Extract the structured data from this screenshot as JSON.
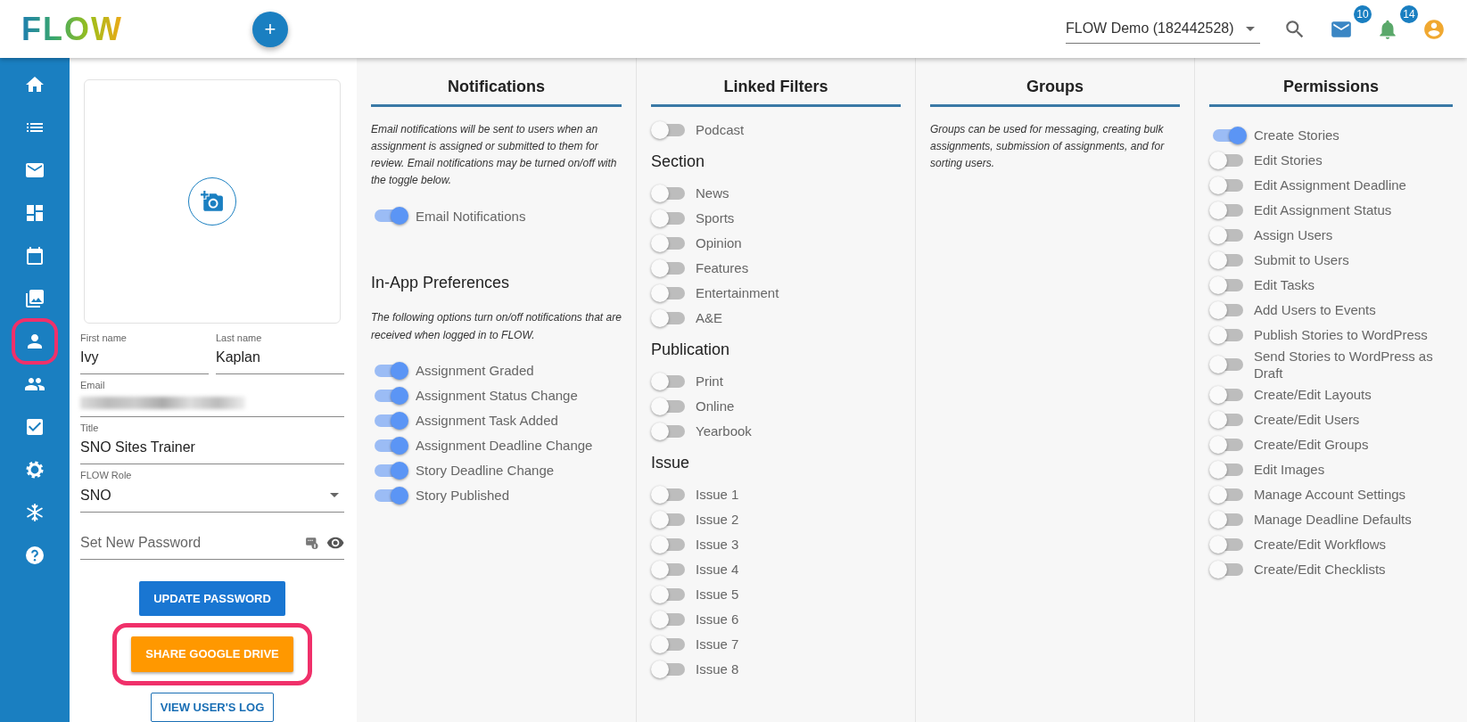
{
  "header": {
    "logo": "FLOW",
    "add_button": "+",
    "account": "FLOW Demo (182442528)",
    "mail_badge": "10",
    "bell_badge": "14"
  },
  "sidebar": {
    "items": [
      {
        "highlighted": false
      },
      {
        "highlighted": false
      },
      {
        "highlighted": false
      },
      {
        "highlighted": false
      },
      {
        "highlighted": false
      },
      {
        "highlighted": false
      },
      {
        "highlighted": true
      },
      {
        "highlighted": false
      },
      {
        "highlighted": false
      },
      {
        "highlighted": false
      },
      {
        "highlighted": false
      },
      {
        "highlighted": false
      }
    ]
  },
  "profile": {
    "fields": [
      {
        "kind": "half_text",
        "label": "First name",
        "value": "Ivy"
      },
      {
        "kind": "half_text",
        "label": "Last name",
        "value": "Kaplan"
      },
      {
        "kind": "redacted",
        "label": "Email"
      },
      {
        "kind": "text",
        "label": "Title",
        "value": "SNO Sites Trainer"
      },
      {
        "kind": "select",
        "label": "FLOW Role",
        "value": "SNO"
      },
      {
        "kind": "password",
        "placeholder": "Set New Password"
      }
    ],
    "buttons": [
      {
        "kind": "primary",
        "label": "UPDATE PASSWORD",
        "highlighted": false
      },
      {
        "kind": "warning",
        "label": "SHARE GOOGLE DRIVE",
        "highlighted": true
      },
      {
        "kind": "outline",
        "label": "VIEW USER'S LOG",
        "highlighted": false
      }
    ]
  },
  "notifications": {
    "title": "Notifications",
    "intro": "Email notifications will be sent to users when an assignment is assigned or submitted to them for review. Email notifications may be turned on/off with the toggle below.",
    "toggles": [
      {
        "label": "Email Notifications",
        "on": true
      }
    ],
    "sub_heading": "In-App Preferences",
    "sub_intro": "The following options turn on/off notifications that are received when logged in to FLOW.",
    "preferences": [
      {
        "label": "Assignment Graded",
        "on": true
      },
      {
        "label": "Assignment Status Change",
        "on": true
      },
      {
        "label": "Assignment Task Added",
        "on": true
      },
      {
        "label": "Assignment Deadline Change",
        "on": true
      },
      {
        "label": "Story Deadline Change",
        "on": true
      },
      {
        "label": "Story Published",
        "on": true
      }
    ]
  },
  "linked_filters": {
    "title": "Linked Filters",
    "groups": [
      {
        "toggles": [
          {
            "label": "Podcast",
            "on": false
          }
        ]
      },
      {
        "heading": "Section",
        "toggles": [
          {
            "label": "News",
            "on": false
          },
          {
            "label": "Sports",
            "on": false
          },
          {
            "label": "Opinion",
            "on": false
          },
          {
            "label": "Features",
            "on": false
          },
          {
            "label": "Entertainment",
            "on": false
          },
          {
            "label": "A&E",
            "on": false
          }
        ]
      },
      {
        "heading": "Publication",
        "toggles": [
          {
            "label": "Print",
            "on": false
          },
          {
            "label": "Online",
            "on": false
          },
          {
            "label": "Yearbook",
            "on": false
          }
        ]
      },
      {
        "heading": "Issue",
        "toggles": [
          {
            "label": "Issue 1",
            "on": false
          },
          {
            "label": "Issue 2",
            "on": false
          },
          {
            "label": "Issue 3",
            "on": false
          },
          {
            "label": "Issue 4",
            "on": false
          },
          {
            "label": "Issue 5",
            "on": false
          },
          {
            "label": "Issue 6",
            "on": false
          },
          {
            "label": "Issue 7",
            "on": false
          },
          {
            "label": "Issue 8",
            "on": false
          }
        ]
      }
    ]
  },
  "groups": {
    "title": "Groups",
    "intro": "Groups can be used for messaging, creating bulk assignments, submission of assignments, and for sorting users."
  },
  "permissions": {
    "title": "Permissions",
    "toggles": [
      {
        "label": "Create Stories",
        "on": true
      },
      {
        "label": "Edit Stories",
        "on": false
      },
      {
        "label": "Edit Assignment Deadline",
        "on": false
      },
      {
        "label": "Edit Assignment Status",
        "on": false
      },
      {
        "label": "Assign Users",
        "on": false
      },
      {
        "label": "Submit to Users",
        "on": false
      },
      {
        "label": "Edit Tasks",
        "on": false
      },
      {
        "label": "Add Users to Events",
        "on": false
      },
      {
        "label": "Publish Stories to WordPress",
        "on": false
      },
      {
        "label": "Send Stories to WordPress as Draft",
        "on": false
      },
      {
        "label": "Create/Edit Layouts",
        "on": false
      },
      {
        "label": "Create/Edit Users",
        "on": false
      },
      {
        "label": "Create/Edit Groups",
        "on": false
      },
      {
        "label": "Edit Images",
        "on": false
      },
      {
        "label": "Manage Account Settings",
        "on": false
      },
      {
        "label": "Manage Deadline Defaults",
        "on": false
      },
      {
        "label": "Create/Edit Workflows",
        "on": false
      },
      {
        "label": "Create/Edit Checklists",
        "on": false
      }
    ]
  }
}
